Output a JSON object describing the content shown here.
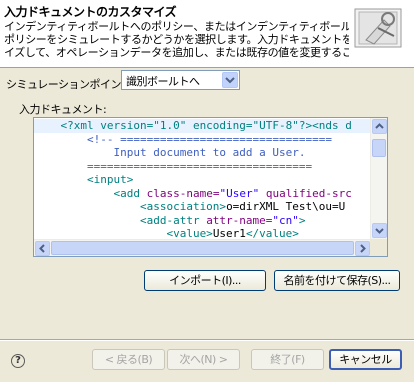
{
  "header": {
    "title": "入力ドキュメントのカスタマイズ",
    "description_lines": [
      "インデンティティボールトへのポリシー、またはインデンティティボールトからの",
      "ポリシーをシミュレートするかどうかを選択します。入力ドキュメントをカスタマ",
      "イズして、オペレーションデータを追加し、または既存の値を変更することも"
    ]
  },
  "simulation_point": {
    "label": "シミュレーションポイント:",
    "value": "識別ボールトへ"
  },
  "input_document": {
    "label": "入力ドキュメント:",
    "lines": [
      {
        "segments": [
          [
            "t",
            "    <?xml version=\"1.0\" encoding=\"UTF-8\"?><nds d"
          ]
        ]
      },
      {
        "segments": [
          [
            "c",
            "        <!-- ================================"
          ]
        ]
      },
      {
        "segments": [
          [
            "c",
            "            Input document to add a User."
          ]
        ]
      },
      {
        "segments": [
          [
            "c",
            "        =================================="
          ]
        ]
      },
      {
        "segments": [
          [
            "t",
            "        <input>"
          ]
        ]
      },
      {
        "segments": [
          [
            "t",
            "            <add "
          ],
          [
            "a",
            "class-name="
          ],
          [
            "v",
            "\"User\""
          ],
          [
            "a",
            " qualified-src"
          ]
        ]
      },
      {
        "segments": [
          [
            "t",
            "                <association>"
          ],
          [
            "x",
            "o=dirXML Test\\ou=U"
          ]
        ]
      },
      {
        "segments": [
          [
            "t",
            "                <add-attr "
          ],
          [
            "a",
            "attr-name="
          ],
          [
            "v",
            "\"cn\""
          ],
          [
            "t",
            ">"
          ]
        ]
      },
      {
        "segments": [
          [
            "t",
            "                    <value>"
          ],
          [
            "x",
            "User1"
          ],
          [
            "t",
            "</value>"
          ]
        ]
      }
    ]
  },
  "buttons": {
    "import": "インポート(I)...",
    "save_as": "名前を付けて保存(S)...",
    "back": "< 戻る(B)",
    "next": "次へ(N) >",
    "finish": "終了(F)",
    "cancel": "キャンセル"
  },
  "colors": {
    "tag": "#008080",
    "attr": "#7f007f",
    "value": "#2a00ff",
    "comment": "#3f5fbf",
    "highlight_line": "#e8f2fe"
  }
}
